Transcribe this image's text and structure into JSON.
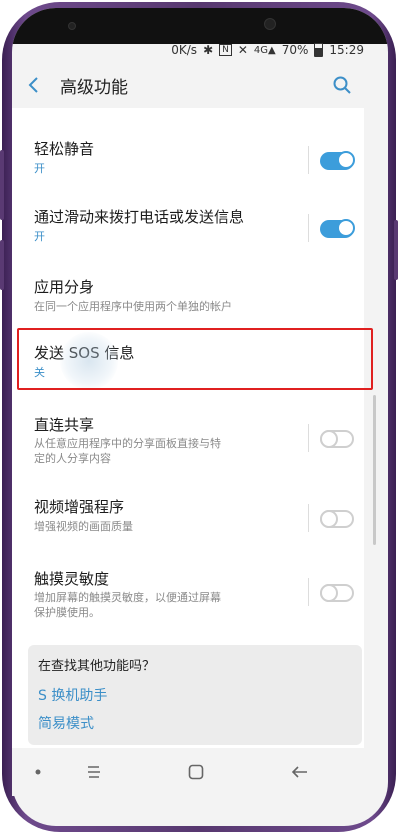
{
  "status_bar": {
    "net_speed": "0K/s",
    "battery": "70%",
    "time": "15:29"
  },
  "header": {
    "title": "高级功能"
  },
  "items": [
    {
      "title": "轻松静音",
      "subtitle": "开",
      "toggle": "on"
    },
    {
      "title": "通过滑动来拨打电话或发送信息",
      "subtitle": "开",
      "toggle": "on"
    },
    {
      "title": "应用分身",
      "subtitle": "在同一个应用程序中使用两个单独的帐户",
      "toggle": null
    },
    {
      "title": "发送 SOS 信息",
      "subtitle": "关",
      "toggle": null
    },
    {
      "title": "直连共享",
      "subtitle_line1": "从任意应用程序中的分享面板直接与特",
      "subtitle_line2": "定的人分享内容",
      "toggle": "off"
    },
    {
      "title": "视频增强程序",
      "subtitle": "增强视频的画面质量",
      "toggle": "off"
    },
    {
      "title": "触摸灵敏度",
      "subtitle_line1": "增加屏幕的触摸灵敏度，以便通过屏幕",
      "subtitle_line2": "保护膜使用。",
      "toggle": "off"
    }
  ],
  "suggestions": {
    "heading": "在查找其他功能吗？",
    "links": [
      "S 换机助手",
      "简易模式"
    ]
  },
  "colors": {
    "accent": "#3c9ddb",
    "highlight": "#e02020",
    "link": "#3c8fc8",
    "phone_body": "#57386f"
  }
}
